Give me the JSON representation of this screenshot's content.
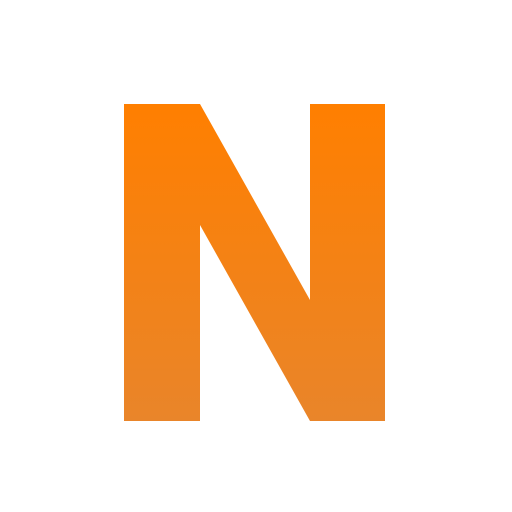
{
  "logo": {
    "letter": "N",
    "colors": {
      "gradient_top": "#ff7f00",
      "gradient_bottom": "#e9852a",
      "background": "#ffffff"
    }
  }
}
